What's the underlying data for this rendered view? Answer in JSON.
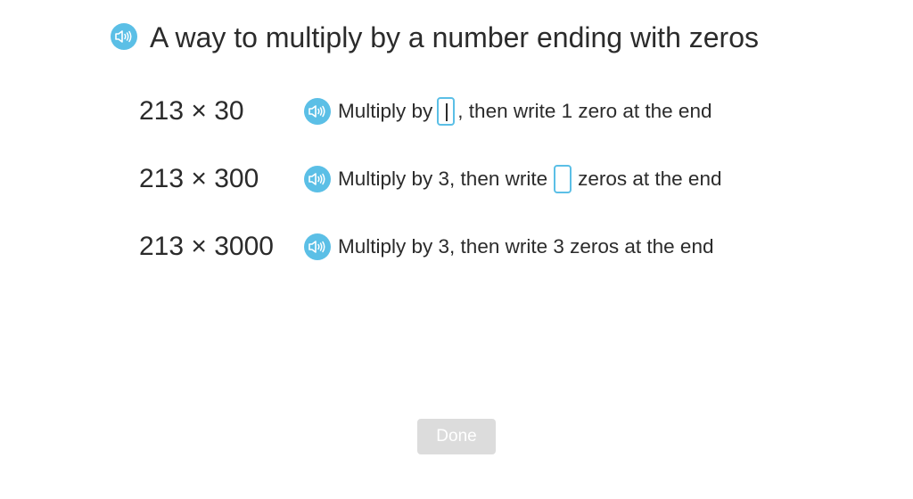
{
  "title": "A way to multiply by a number ending with zeros",
  "rows": [
    {
      "expression": "213 × 30",
      "before": "Multiply by",
      "after": ", then write 1 zero at the end"
    },
    {
      "expression": "213 × 300",
      "before": "Multiply by 3, then write",
      "after": "zeros at the end"
    },
    {
      "expression": "213 × 3000",
      "text": "Multiply by 3, then write 3 zeros at the end"
    }
  ],
  "done_label": "Done",
  "colors": {
    "accent": "#5bbfe6",
    "button_disabled": "#dcdcdc"
  },
  "icons": {
    "speaker": "speaker-icon"
  }
}
